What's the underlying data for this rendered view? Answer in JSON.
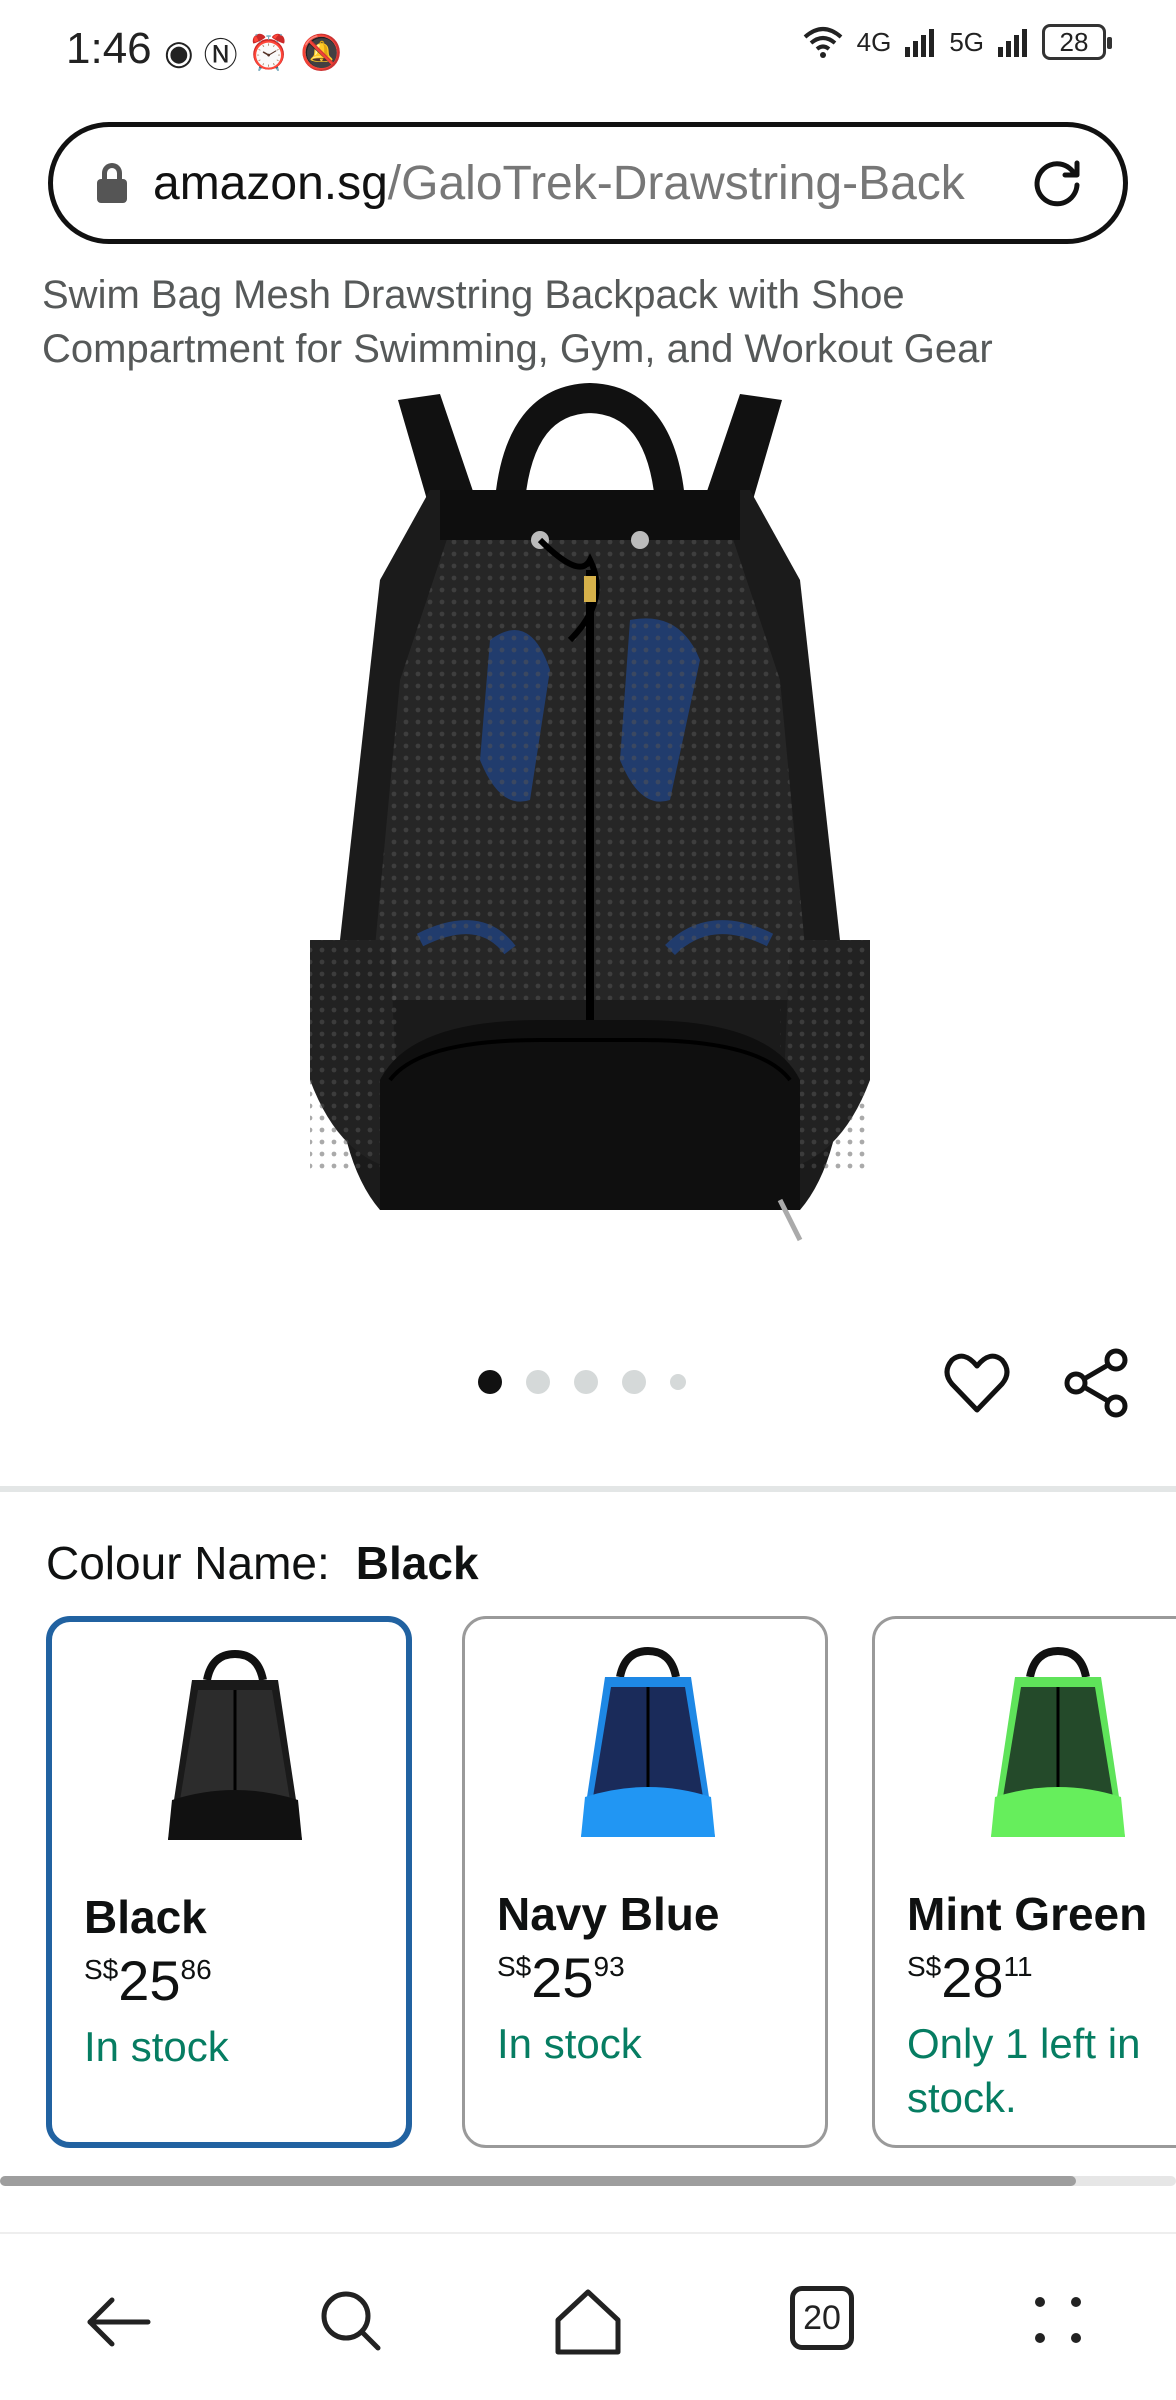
{
  "status_bar": {
    "time": "1:46",
    "icons_left": [
      "eye-icon",
      "nfc-icon",
      "alarm-icon",
      "mute-icon"
    ],
    "signal_1": "4G",
    "signal_2": "5G",
    "battery": "28"
  },
  "browser": {
    "url_domain": "amazon.sg",
    "url_path": "/GaloTrek-Drawstring-Back"
  },
  "product": {
    "title": "Swim Bag Mesh Drawstring Backpack with Shoe Compartment for Swimming, Gym, and Workout Gear",
    "image_count": 5,
    "active_image_index": 0
  },
  "colour": {
    "label": "Colour Name:",
    "selected": "Black",
    "options": [
      {
        "name": "Black",
        "currency": "S$",
        "whole": "25",
        "fraction": "86",
        "stock": "In stock",
        "accent": "#1a1a1a",
        "selected": true
      },
      {
        "name": "Navy Blue",
        "currency": "S$",
        "whole": "25",
        "fraction": "93",
        "stock": "In stock",
        "accent": "#1e88e5",
        "selected": false
      },
      {
        "name": "Mint Green",
        "currency": "S$",
        "whole": "28",
        "fraction": "11",
        "stock": "Only 1 left in stock.",
        "accent": "#5fe35a",
        "selected": false
      }
    ]
  },
  "bottom_nav": {
    "tabs_count": "20"
  },
  "colors": {
    "selected_border": "#2162a1",
    "stock_green": "#067d62"
  }
}
